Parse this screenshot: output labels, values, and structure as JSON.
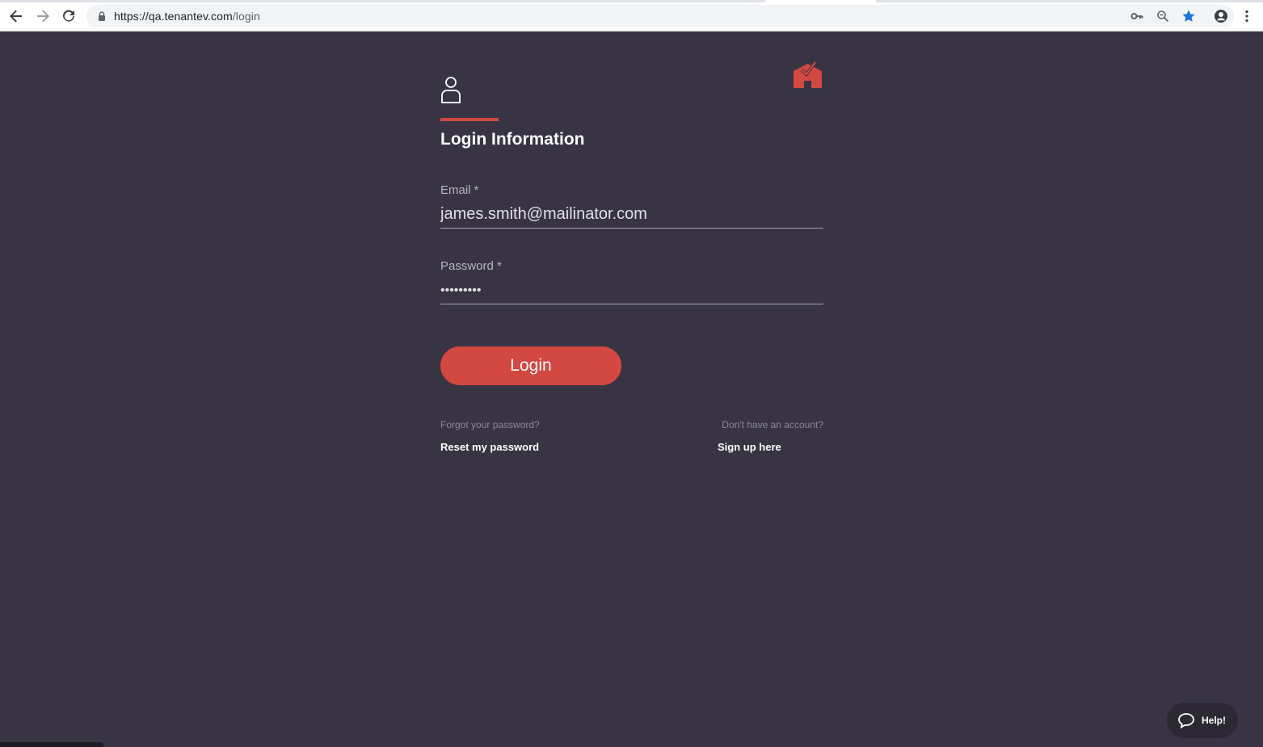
{
  "browser": {
    "url_host": "https://qa.tenantev.com",
    "url_path": "/login",
    "icons": [
      "back-arrow-icon",
      "forward-arrow-icon",
      "reload-icon",
      "lock-icon",
      "key-icon",
      "zoom-icon",
      "star-icon",
      "profile-icon",
      "menu-dots-icon"
    ]
  },
  "colors": {
    "background": "#383443",
    "accent": "#d34841",
    "text_light": "#ffffff",
    "muted": "#8b8795"
  },
  "login": {
    "title": "Login Information",
    "email_label": "Email *",
    "email_value": "james.smith@mailinator.com",
    "password_label": "Password *",
    "password_value": "•••••••••",
    "login_button": "Login",
    "forgot_hint": "Forgot your password?",
    "reset_link": "Reset my password",
    "signup_hint": "Don't have an account?",
    "signup_link": "Sign up here"
  },
  "help": {
    "label": "Help!"
  }
}
